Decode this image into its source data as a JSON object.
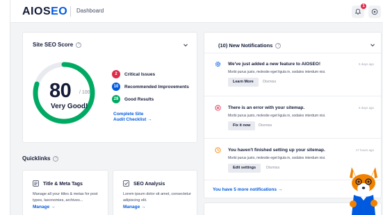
{
  "header": {
    "logo_main": "AIOS",
    "logo_accent": "E",
    "logo_tail": "O",
    "breadcrumb": "Dashboard",
    "notification_count": "1",
    "notifications_icon": "bell-icon",
    "help_icon": "help-circle-icon"
  },
  "seo_score": {
    "title": "Site SEO Score",
    "score": "80",
    "out_of": "/ 100",
    "verdict": "Very Good!",
    "gauge_fraction": 0.8,
    "gauge_color": "#00aa63",
    "legend": [
      {
        "count": "2",
        "label": "Critical Issues",
        "color": "#df2a4a"
      },
      {
        "count": "10",
        "label": "Recommended Improvements",
        "color": "#005ae0"
      },
      {
        "count": "28",
        "label": "Good Results",
        "color": "#00aa63"
      }
    ],
    "audit_link_line1": "Complete Site",
    "audit_link_line2": "Audit Checklist →"
  },
  "quicklinks": {
    "title": "Quicklinks",
    "items": [
      {
        "icon": "title-meta-icon",
        "title": "Title & Meta Tags",
        "description": "Manage all your titles & metas for post types, taxonomies, archives...",
        "link": "Manage →"
      },
      {
        "icon": "seo-analysis-icon",
        "title": "SEO Analysis",
        "description": "Lorem ipsum dolor sit amet, consectetur adipiscing elit.",
        "link": "Manage →"
      }
    ]
  },
  "notifications": {
    "title": "(10) New Notifications",
    "items": [
      {
        "icon": "gear-icon",
        "icon_color": "#005ae0",
        "title": "We've just added a new feature to AIOSEO!",
        "time": "5 days ago",
        "description": "Morbi purus justo, molestie eget ligula in, sodales interdum nisi.",
        "button": "Learn More",
        "dismiss": "Dismiss"
      },
      {
        "icon": "error-x-icon",
        "icon_color": "#df2a4a",
        "title": "There is an error with your sitemap.",
        "time": "5 days ago",
        "description": "Morbi purus justo, molestie eget ligula in, sodales interdum nisi.",
        "button": "Fix it now",
        "dismiss": "Dismiss"
      },
      {
        "icon": "clock-icon",
        "icon_color": "#f18200",
        "title": "You haven't finished setting up your sitemap.",
        "time": "17 hours ago",
        "description": "Morbi purus justo, molestie eget ligula in, sodales interdum nisi.",
        "button": "Edit settings",
        "dismiss": "Dismiss"
      }
    ],
    "more_link": "You have 5 more notifications →"
  },
  "mascot": {
    "icon": "fox-mascot-icon"
  }
}
